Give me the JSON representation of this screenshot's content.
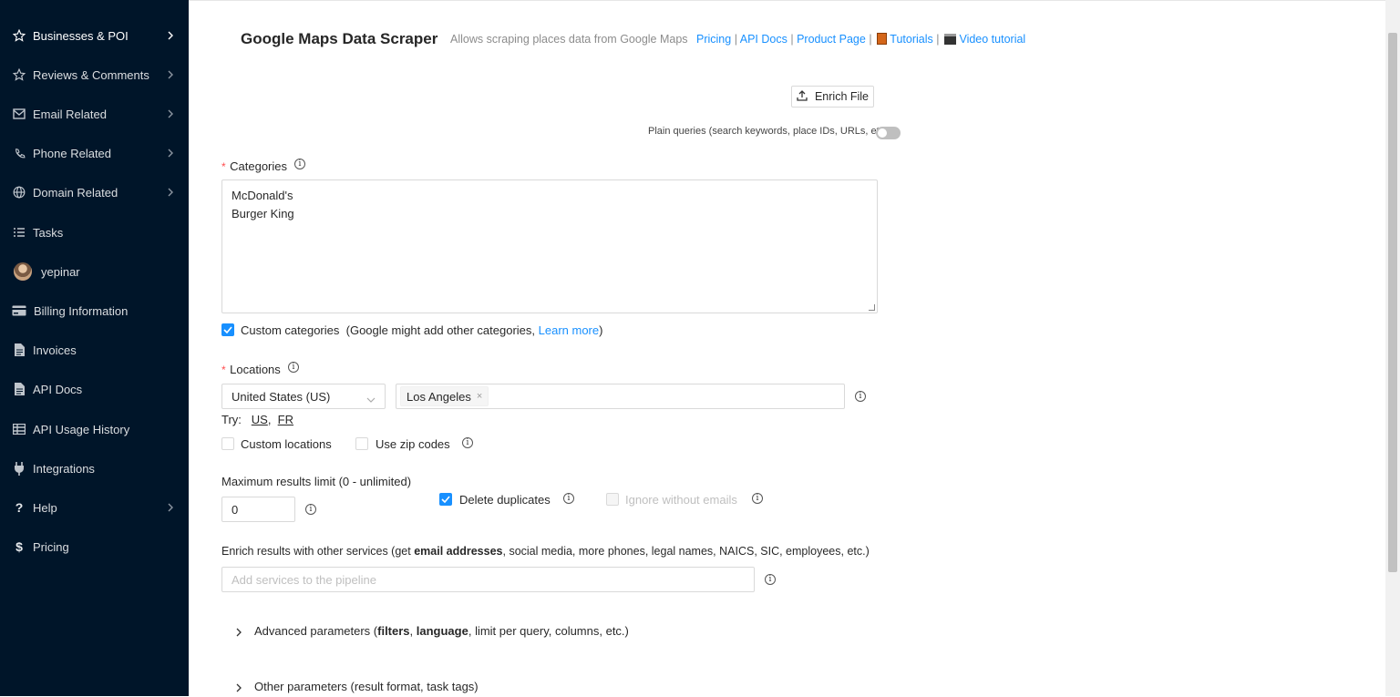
{
  "sidebar": {
    "items": [
      {
        "label": "Businesses & POI",
        "icon": "star-icon",
        "has_chevron": true
      },
      {
        "label": "Reviews & Comments",
        "icon": "star-outline-icon",
        "has_chevron": true
      },
      {
        "label": "Email Related",
        "icon": "mail-icon",
        "has_chevron": true
      },
      {
        "label": "Phone Related",
        "icon": "phone-icon",
        "has_chevron": true
      },
      {
        "label": "Domain Related",
        "icon": "globe-icon",
        "has_chevron": true
      },
      {
        "label": "Tasks",
        "icon": "list-icon",
        "has_chevron": false
      },
      {
        "label": "yepinar",
        "icon": "avatar",
        "has_chevron": false
      },
      {
        "label": "Billing Information",
        "icon": "credit-card-icon",
        "has_chevron": false
      },
      {
        "label": "Invoices",
        "icon": "file-icon",
        "has_chevron": false
      },
      {
        "label": "API Docs",
        "icon": "file-text-icon",
        "has_chevron": false
      },
      {
        "label": "API Usage History",
        "icon": "table-icon",
        "has_chevron": false
      },
      {
        "label": "Integrations",
        "icon": "plug-icon",
        "has_chevron": false
      },
      {
        "label": "Help",
        "icon": "question-icon",
        "has_chevron": true
      },
      {
        "label": "Pricing",
        "icon": "dollar-icon",
        "has_chevron": false
      }
    ]
  },
  "header": {
    "title": "Google Maps Data Scraper",
    "subtitle": "Allows scraping places data from Google Maps",
    "links": {
      "pricing": "Pricing",
      "api_docs": "API Docs",
      "product_page": "Product Page",
      "tutorials": "Tutorials",
      "video_tutorial": "Video tutorial"
    },
    "separator": "|"
  },
  "enrich_button": "Enrich File",
  "plain_queries": {
    "label": "Plain queries (search keywords, place IDs, URLs, etc.)",
    "enabled": false
  },
  "categories": {
    "required_mark": "*",
    "label": "Categories",
    "lines": [
      "McDonald's",
      "Burger King"
    ],
    "custom_checkbox": {
      "checked": true,
      "label": "Custom categories",
      "note_prefix": "(Google might add other categories, ",
      "note_link": "Learn more",
      "note_suffix": ")"
    }
  },
  "locations": {
    "required_mark": "*",
    "label": "Locations",
    "country": "United States (US)",
    "tags": [
      "Los Angeles"
    ],
    "try_label": "Try:",
    "try_options": [
      "US",
      "FR"
    ],
    "try_sep": ",",
    "custom_locations": {
      "checked": false,
      "label": "Custom locations"
    },
    "zip_codes": {
      "checked": false,
      "label": "Use zip codes"
    }
  },
  "limits": {
    "max_label": "Maximum results limit (0 - unlimited)",
    "max_value": "0",
    "delete_duplicates": {
      "checked": true,
      "label": "Delete duplicates"
    },
    "ignore_without_emails": {
      "checked": false,
      "disabled": true,
      "label": "Ignore without emails"
    }
  },
  "enrich": {
    "label_prefix": "Enrich results with other services (get ",
    "label_bold": "email addresses",
    "label_suffix": ", social media, more phones, legal names, NAICS, SIC, employees, etc.)",
    "placeholder": "Add services to the pipeline"
  },
  "advanced": {
    "prefix": "Advanced parameters (",
    "bold1": "filters",
    "mid": ", ",
    "bold2": "language",
    "suffix": ", limit per query, columns, etc.)"
  },
  "other": {
    "label": "Other parameters (result format, task tags)"
  },
  "colors": {
    "sidebar_bg": "#001529",
    "link": "#1890ff",
    "required": "#ff4d4f"
  }
}
